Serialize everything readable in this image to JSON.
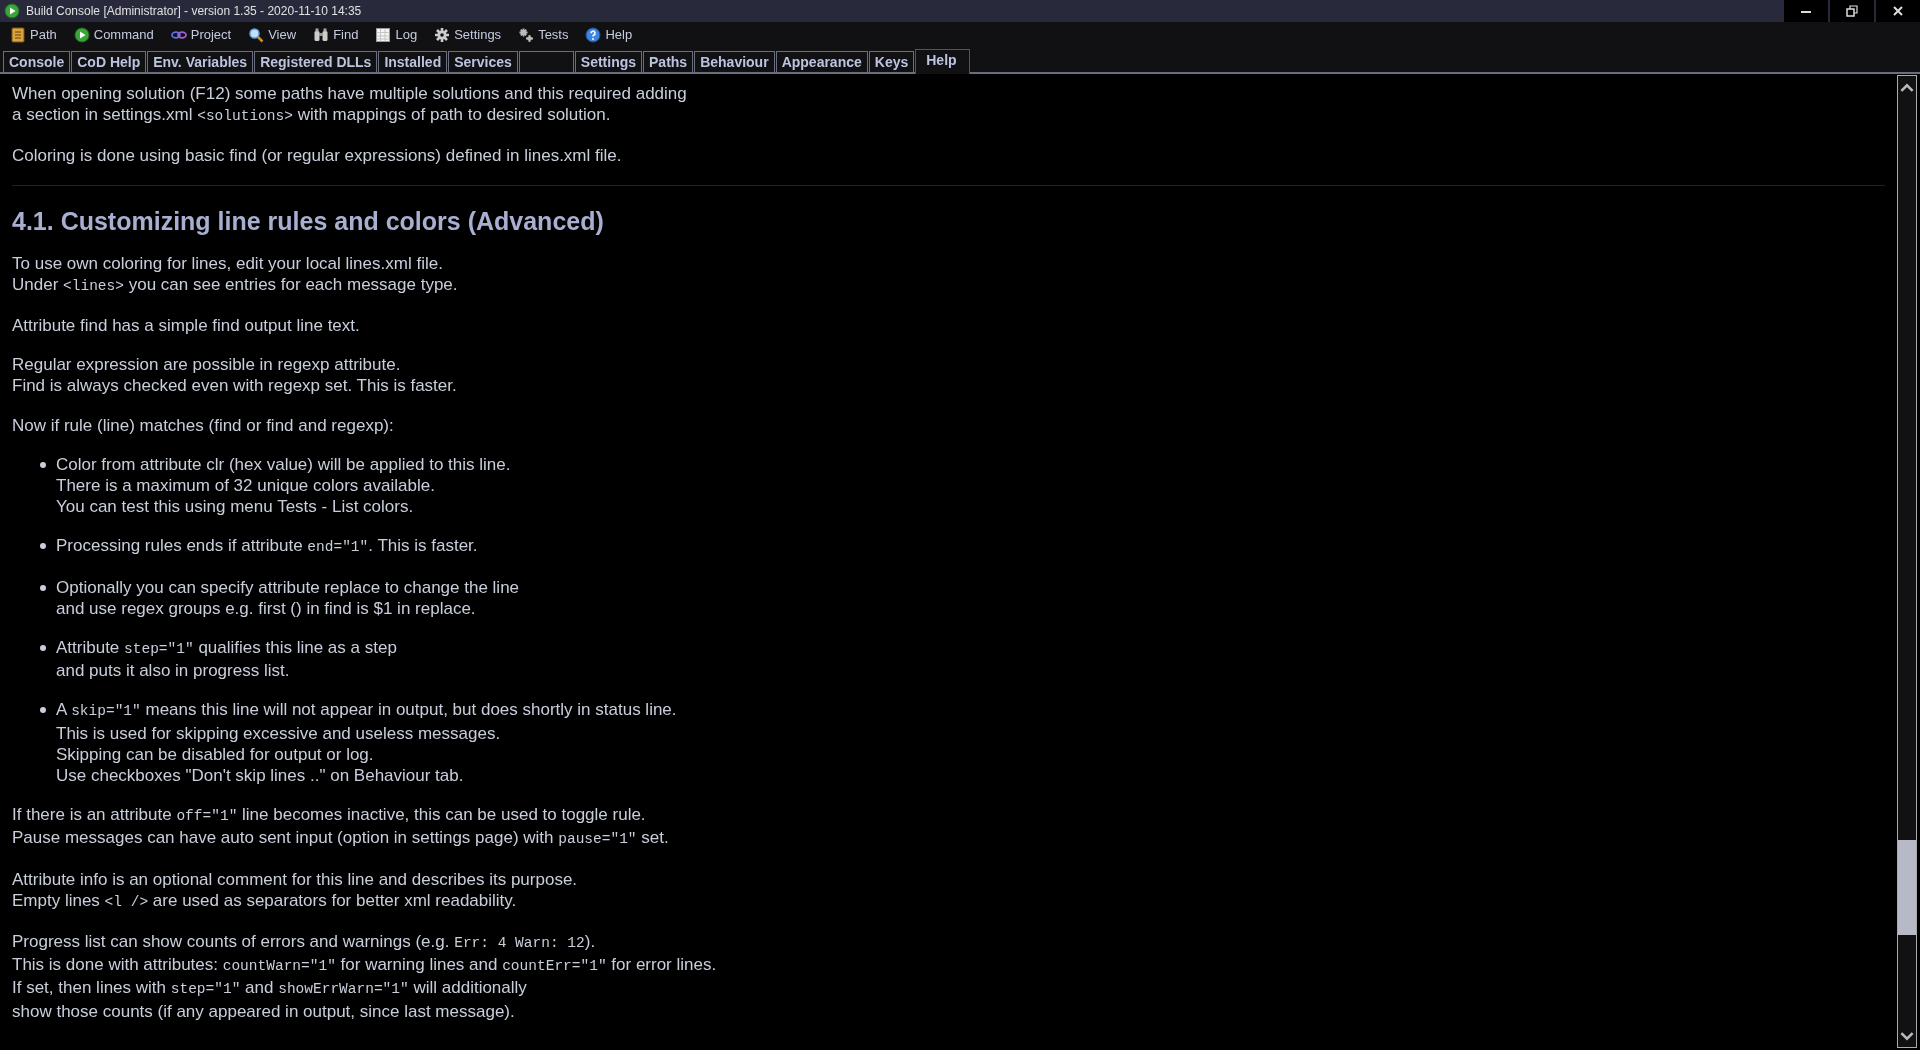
{
  "window": {
    "title": "Build Console [Administrator] - version 1.35 - 2020-11-10 14:35"
  },
  "menu": [
    {
      "label": "Path"
    },
    {
      "label": "Command"
    },
    {
      "label": "Project"
    },
    {
      "label": "View"
    },
    {
      "label": "Find"
    },
    {
      "label": "Log"
    },
    {
      "label": "Settings"
    },
    {
      "label": "Tests"
    },
    {
      "label": "Help"
    }
  ],
  "tabs": [
    {
      "label": "Console",
      "selected": false
    },
    {
      "label": "CoD Help",
      "selected": false
    },
    {
      "label": "Env. Variables",
      "selected": false
    },
    {
      "label": "Registered DLLs",
      "selected": false
    },
    {
      "label": "Installed",
      "selected": false
    },
    {
      "label": "Services",
      "selected": false
    },
    {
      "selected": false
    },
    {
      "label": "Settings",
      "selected": false
    },
    {
      "label": "Paths",
      "selected": false
    },
    {
      "label": "Behaviour",
      "selected": false
    },
    {
      "label": "Appearance",
      "selected": false
    },
    {
      "label": "Keys",
      "selected": false
    },
    {
      "label": "Help",
      "selected": true
    }
  ],
  "content": [
    {
      "kind": "para",
      "lines": [
        [
          "When opening solution (F12) some paths have multiple solutions and this required adding"
        ],
        [
          "a section in settings.xml ",
          "<solutions>",
          " with mappings of path to desired solution."
        ]
      ]
    },
    {
      "kind": "para",
      "lines": [
        [
          "Coloring is done using basic find (or regular expressions) defined in lines.xml file."
        ]
      ]
    },
    {
      "kind": "rule"
    },
    {
      "kind": "heading",
      "text": "4.1. Customizing line rules and colors (Advanced)"
    },
    {
      "kind": "para",
      "lines": [
        [
          "To use own coloring for lines, edit your local lines.xml file."
        ],
        [
          "Under ",
          "<lines>",
          " you can see entries for each message type."
        ]
      ]
    },
    {
      "kind": "para",
      "lines": [
        [
          "Attribute find has a simple find output line text."
        ]
      ]
    },
    {
      "kind": "para",
      "lines": [
        [
          "Regular expression are possible in regexp attribute."
        ],
        [
          "Find is always checked even with regexp set. This is faster."
        ]
      ]
    },
    {
      "kind": "para",
      "lines": [
        [
          "Now if rule (line) matches (find or find and regexp):"
        ]
      ]
    },
    {
      "kind": "list",
      "items": [
        {
          "lines": [
            [
              "Color from attribute clr (hex value) will be applied to this line."
            ],
            [
              "There is a maximum of 32 unique colors available."
            ],
            [
              "You can test this using menu Tests - List colors."
            ]
          ]
        },
        {
          "lines": [
            [
              "Processing rules ends if attribute ",
              "end=\"1\"",
              ". This is faster."
            ]
          ]
        },
        {
          "lines": [
            [
              "Optionally you can specify attribute replace to change the line"
            ],
            [
              "and use regex groups e.g. first () in find is $1 in replace."
            ]
          ]
        },
        {
          "lines": [
            [
              "Attribute ",
              "step=\"1\"",
              " qualifies this line as a step"
            ],
            [
              "and puts it also in progress list."
            ]
          ]
        },
        {
          "lines": [
            [
              "A ",
              "skip=\"1\"",
              " means this line will not appear in output, but does shortly in status line."
            ],
            [
              "This is used for skipping excessive and useless messages."
            ],
            [
              "Skipping can be disabled for output or log."
            ],
            [
              "Use checkboxes \"Don't skip lines ..\" on Behaviour tab."
            ]
          ]
        }
      ]
    },
    {
      "kind": "para",
      "lines": [
        [
          "If there is an attribute ",
          "off=\"1\"",
          " line becomes inactive, this can be used to toggle rule."
        ],
        [
          "Pause messages can have auto sent input (option in settings page) with ",
          "pause=\"1\"",
          " set."
        ]
      ]
    },
    {
      "kind": "para",
      "lines": [
        [
          "Attribute info is an optional comment for this line and describes its purpose."
        ],
        [
          "Empty lines ",
          "<l />",
          " are used as separators for better xml readability."
        ]
      ]
    },
    {
      "kind": "para",
      "lines": [
        [
          "Progress list can show counts of errors and warnings (e.g. ",
          "Err: 4 Warn: 12",
          ")."
        ],
        [
          "This is done with attributes: ",
          "countWarn=\"1\"",
          " for warning lines and ",
          "countErr=\"1\"",
          " for error lines."
        ],
        [
          "If set, then lines with ",
          "step=\"1\"",
          " and ",
          "showErrWarn=\"1\"",
          " will additionally"
        ],
        [
          "show those counts (if any appeared in output, since last message)."
        ]
      ]
    }
  ]
}
